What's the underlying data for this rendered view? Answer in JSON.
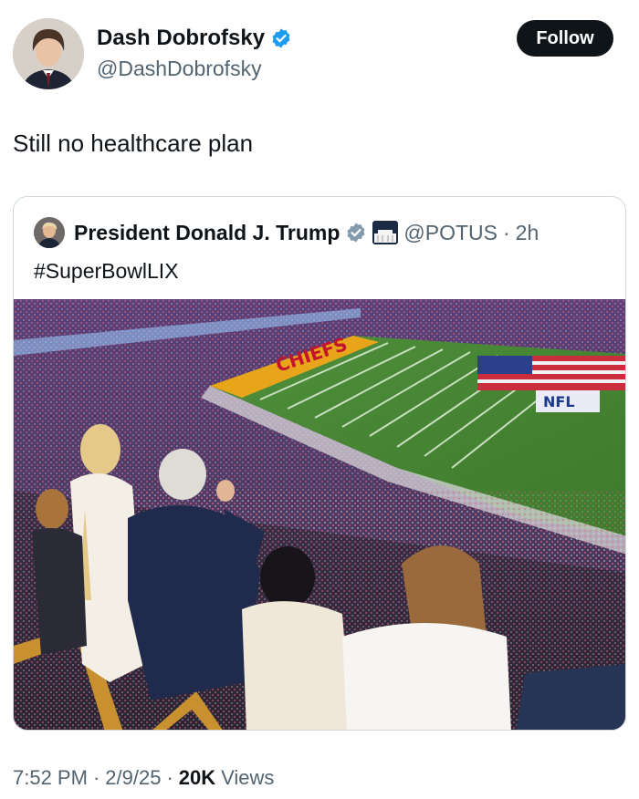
{
  "author": {
    "name": "Dash Dobrofsky",
    "handle": "@DashDobrofsky",
    "avatar_icon": "person-avatar",
    "verified_color": "#1d9bf0"
  },
  "follow_label": "Follow",
  "tweet": {
    "text": "Still no healthcare plan"
  },
  "quoted": {
    "name": "President Donald J. Trump",
    "handle": "@POTUS",
    "separator": "·",
    "time": "2h",
    "text": "#SuperBowlLIX",
    "badge_color": "#829aab",
    "image": {
      "description_icon": "stadium-photo",
      "banner_text": "CHIEFS",
      "flag_text": "NFL"
    }
  },
  "meta": {
    "time": "7:52 PM",
    "sep1": "·",
    "date": "2/9/25",
    "sep2": "·",
    "views_count": "20K",
    "views_label": "Views"
  }
}
